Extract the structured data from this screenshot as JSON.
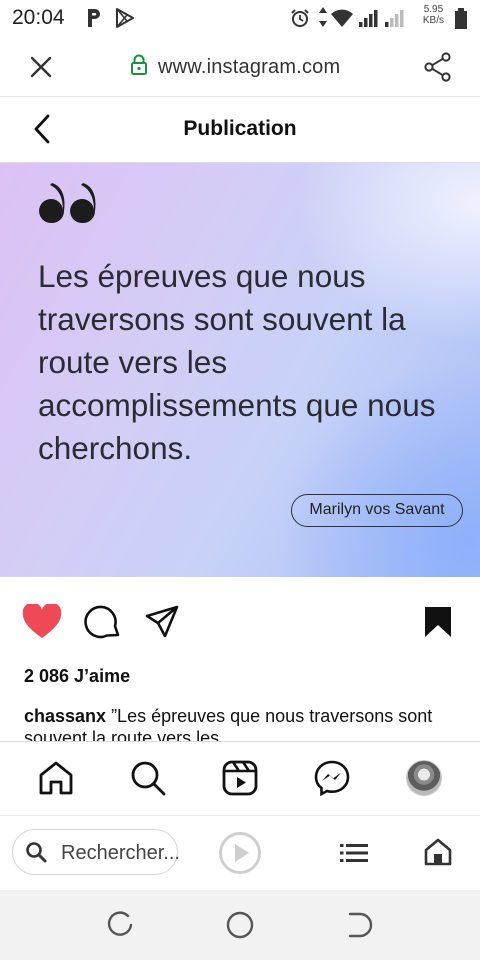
{
  "status_bar": {
    "time": "20:04",
    "net_speed_value": "5.95",
    "net_speed_unit": "KB/s"
  },
  "browser": {
    "url": "www.instagram.com",
    "search_placeholder": "Rechercher..."
  },
  "header": {
    "title": "Publication"
  },
  "post": {
    "quote": "Les épreuves que nous traversons sont souvent la route vers les accomplissements que nous cherchons.",
    "author": "Marilyn vos Savant",
    "likes": "2 086 J’aime",
    "caption_user": "chassanx",
    "caption_text": " ”Les épreuves que nous traversons sont souvent la route vers les"
  },
  "colors": {
    "like_red": "#ed4956",
    "text_dark": "#111111"
  },
  "icons": {
    "close": "close-icon",
    "lock": "lock-icon",
    "share": "share-icon",
    "back": "chevron-left-icon",
    "like": "heart-icon",
    "comment": "comment-icon",
    "send": "send-icon",
    "save": "bookmark-icon",
    "home": "home-icon",
    "search": "search-icon",
    "reels": "reels-icon",
    "messenger": "messenger-icon",
    "profile": "avatar",
    "play": "play-icon",
    "menu": "list-icon",
    "browser_home": "home-icon"
  }
}
